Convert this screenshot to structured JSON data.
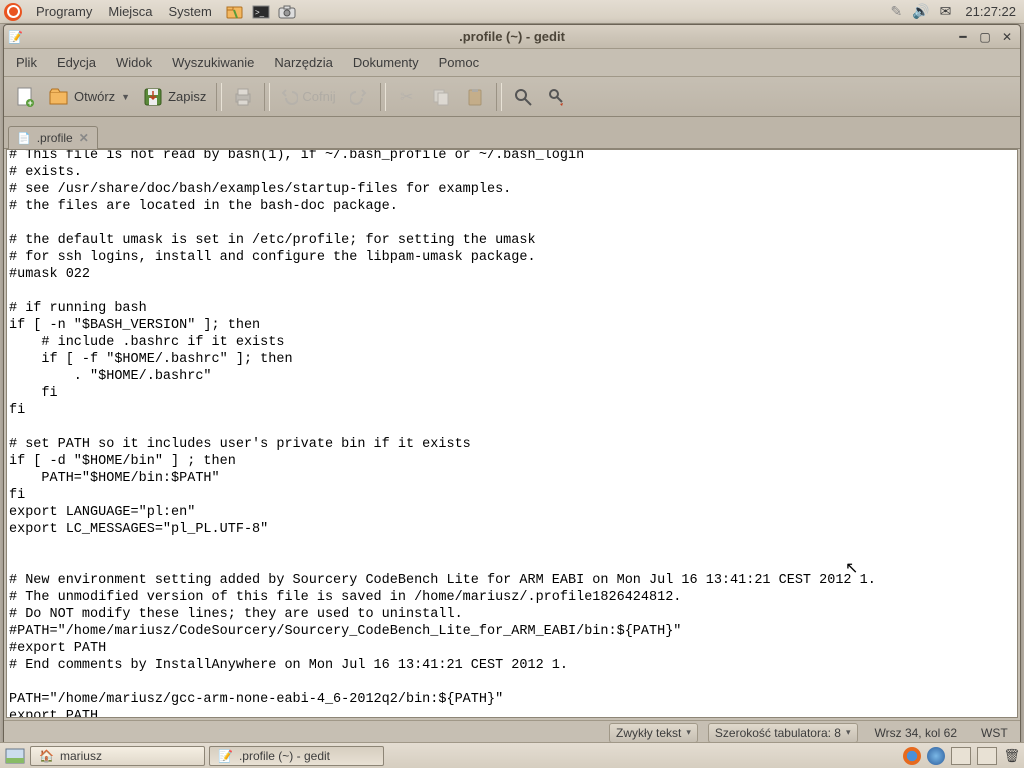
{
  "panel": {
    "menu": [
      "Programy",
      "Miejsca",
      "System"
    ],
    "clock": "21:27:22"
  },
  "window": {
    "title": ".profile (~) - gedit",
    "menubar": [
      "Plik",
      "Edycja",
      "Widok",
      "Wyszukiwanie",
      "Narzędzia",
      "Dokumenty",
      "Pomoc"
    ],
    "toolbar": {
      "open": "Otwórz",
      "save": "Zapisz",
      "undo": "Cofnij"
    },
    "tab": ".profile",
    "content": "# This file is not read by bash(1), if ~/.bash_profile or ~/.bash_login\n# exists.\n# see /usr/share/doc/bash/examples/startup-files for examples.\n# the files are located in the bash-doc package.\n\n# the default umask is set in /etc/profile; for setting the umask\n# for ssh logins, install and configure the libpam-umask package.\n#umask 022\n\n# if running bash\nif [ -n \"$BASH_VERSION\" ]; then\n    # include .bashrc if it exists\n    if [ -f \"$HOME/.bashrc\" ]; then\n        . \"$HOME/.bashrc\"\n    fi\nfi\n\n# set PATH so it includes user's private bin if it exists\nif [ -d \"$HOME/bin\" ] ; then\n    PATH=\"$HOME/bin:$PATH\"\nfi\nexport LANGUAGE=\"pl:en\"\nexport LC_MESSAGES=\"pl_PL.UTF-8\"\n\n\n# New environment setting added by Sourcery CodeBench Lite for ARM EABI on Mon Jul 16 13:41:21 CEST 2012 1.\n# The unmodified version of this file is saved in /home/mariusz/.profile1826424812.\n# Do NOT modify these lines; they are used to uninstall.\n#PATH=\"/home/mariusz/CodeSourcery/Sourcery_CodeBench_Lite_for_ARM_EABI/bin:${PATH}\"\n#export PATH\n# End comments by InstallAnywhere on Mon Jul 16 13:41:21 CEST 2012 1.\n\nPATH=\"/home/mariusz/gcc-arm-none-eabi-4_6-2012q2/bin:${PATH}\"\nexport PATH",
    "status": {
      "syntax": "Zwykły tekst",
      "tabwidth": "Szerokość tabulatora:  8",
      "position": "Wrsz 34, kol 62",
      "insert": "WST"
    }
  },
  "tasks": [
    {
      "label": "mariusz",
      "active": false
    },
    {
      "label": ".profile (~) - gedit",
      "active": true
    }
  ]
}
